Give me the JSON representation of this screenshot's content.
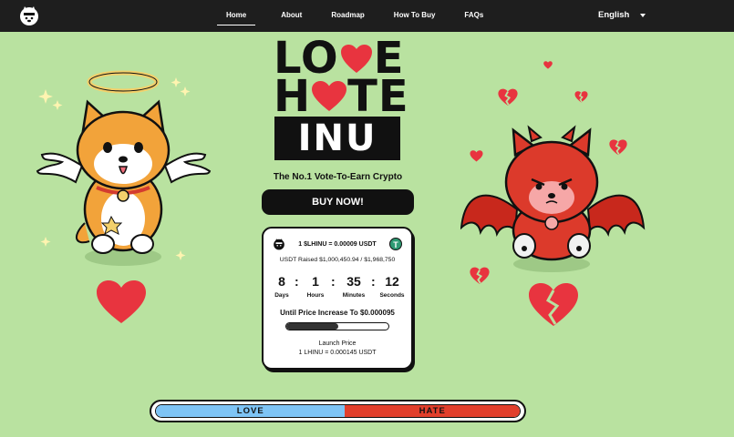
{
  "nav": {
    "links": [
      {
        "label": "Home",
        "active": true
      },
      {
        "label": "About",
        "active": false
      },
      {
        "label": "Roadmap",
        "active": false
      },
      {
        "label": "How To Buy",
        "active": false
      },
      {
        "label": "FAQs",
        "active": false
      }
    ],
    "language": "English"
  },
  "hero": {
    "title_line1": "LO",
    "title_line1_end": "E",
    "title_line2_start": "H",
    "title_line2_end": "TE",
    "title_line3": "INU",
    "tagline": "The No.1 Vote-To-Earn Crypto",
    "buy_button": "BUY NOW!"
  },
  "presale": {
    "price_line": "1 $LHINU = 0.00009 USDT",
    "currency_icon": "T",
    "raised": "USDT Raised $1,000,450.94 / $1,968,750",
    "countdown": [
      {
        "value": "8",
        "label": "Days"
      },
      {
        "value": "1",
        "label": "Hours"
      },
      {
        "value": "35",
        "label": "Minutes"
      },
      {
        "value": "12",
        "label": "Seconds"
      }
    ],
    "until": "Until Price Increase To $0.000095",
    "progress_fraction": 0.51,
    "launch_label": "Launch Price",
    "launch_value": "1 LHINU = 0.000145 USDT"
  },
  "vote": {
    "love_label": "LOVE",
    "hate_label": "HATE",
    "love_fraction": 0.52
  },
  "colors": {
    "background": "#b9e2a0",
    "nav": "#1e1e1e",
    "love": "#7ec4f5",
    "hate": "#e13f2c",
    "heart": "#e8343f"
  },
  "icons": [
    "dog-logo-icon",
    "caret-down-icon",
    "tether-icon",
    "angel-dog-icon",
    "devil-dog-icon",
    "heart-icon",
    "broken-heart-icon",
    "sparkle-icon"
  ]
}
